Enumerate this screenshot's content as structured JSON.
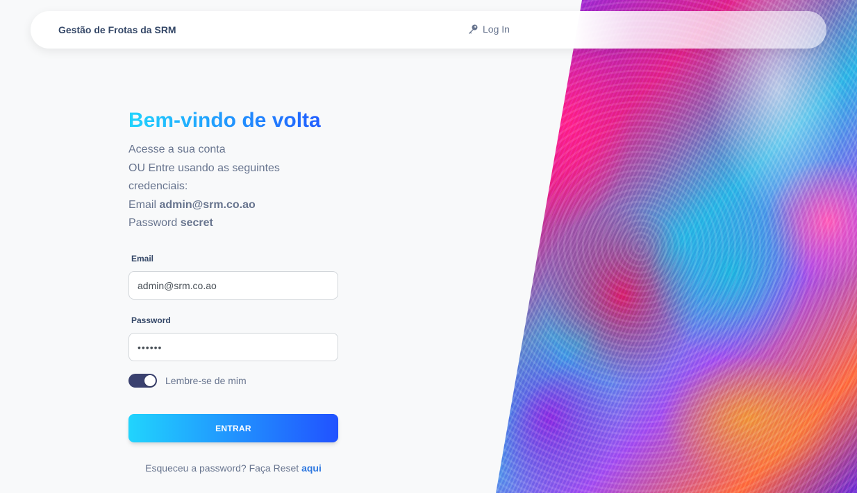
{
  "colors": {
    "gradient_start": "#21d4fd",
    "gradient_end": "#2152ff",
    "heading": "#344767",
    "text": "#67748e",
    "switch_on": "#3a416f"
  },
  "navbar": {
    "brand": "Gestão de Frotas da SRM",
    "login_icon": "key-icon",
    "login_label": "Log In"
  },
  "login": {
    "title": "Bem-vindo de volta",
    "intro_line1": "Acesse a sua conta",
    "intro_line2": "OU Entre usando as seguintes credenciais:",
    "email_prefix": "Email",
    "email_value": "admin@srm.co.ao",
    "password_prefix": "Password",
    "password_value": "secret",
    "email_label": "Email",
    "email_input": "admin@srm.co.ao",
    "password_label": "Password",
    "password_input": "secret",
    "remember_label": "Lembre-se de mim",
    "remember_checked": true,
    "submit_label": "ENTRAR",
    "forgot_text": "Esqueceu a password? Faça Reset",
    "forgot_link": "aqui"
  }
}
